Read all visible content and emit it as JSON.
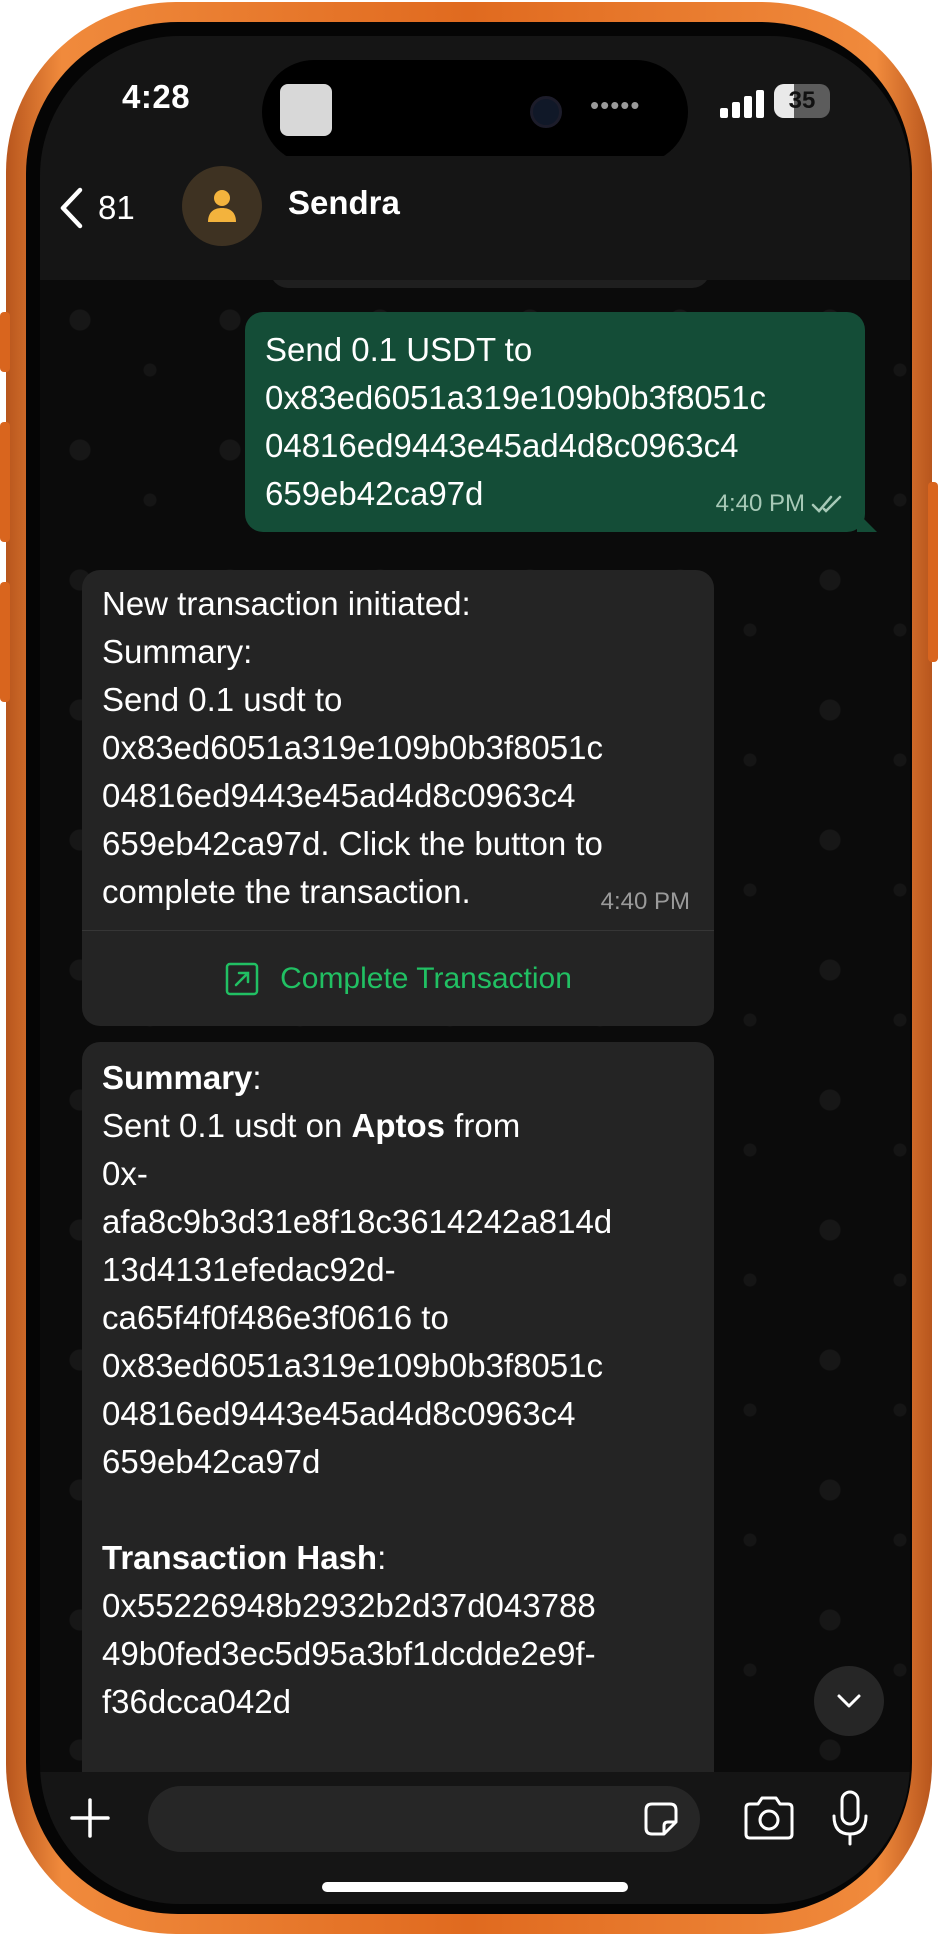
{
  "status_bar": {
    "time": "4:28",
    "battery_level": "35"
  },
  "header": {
    "back_count": "81",
    "contact_name": "Sendra"
  },
  "messages": {
    "outgoing": {
      "text": "Send 0.1 USDT to\n0x83ed6051a319e109b0b3f8051c\n04816ed9443e45ad4d8c0963c4\n659eb42ca97d",
      "time": "4:40 PM"
    },
    "incoming1": {
      "text": "New transaction initiated:\nSummary:\nSend 0.1 usdt to\n0x83ed6051a319e109b0b3f8051c\n04816ed9443e45ad4d8c0963c4\n659eb42ca97d. Click the button to\ncomplete the transaction.",
      "time": "4:40 PM",
      "action_label": "Complete Transaction"
    },
    "incoming2": {
      "summary_label": "Summary",
      "sent_prefix": "Sent 0.1 usdt on ",
      "network": "Aptos",
      "from_word": " from",
      "from_lines": [
        "0x-",
        "afa8c9b3d31e8f18c3614242a814d",
        "13d4131efedac92d-",
        "ca65f4f0f486e3f0616 to"
      ],
      "to_lines": [
        "0x83ed6051a319e109b0b3f8051c",
        "04816ed9443e45ad4d8c0963c4",
        "659eb42ca97d"
      ],
      "hash_label": "Transaction Hash",
      "hash_lines": [
        "0x55226948b2932b2d37d043788",
        "49b0fed3ec5d95a3bf1dcdde2e9f-",
        "f36dcca042d"
      ]
    }
  },
  "input": {
    "placeholder": ""
  },
  "colors": {
    "frame": "#e87a2e",
    "outgoing_bubble": "#144d37",
    "incoming_bubble": "#242424",
    "accent_green": "#21c063"
  },
  "icons": [
    "back-chevron-icon",
    "person-icon",
    "read-receipt-icon",
    "external-link-icon",
    "chevron-down-icon",
    "plus-icon",
    "sticker-icon",
    "camera-icon",
    "microphone-icon"
  ]
}
